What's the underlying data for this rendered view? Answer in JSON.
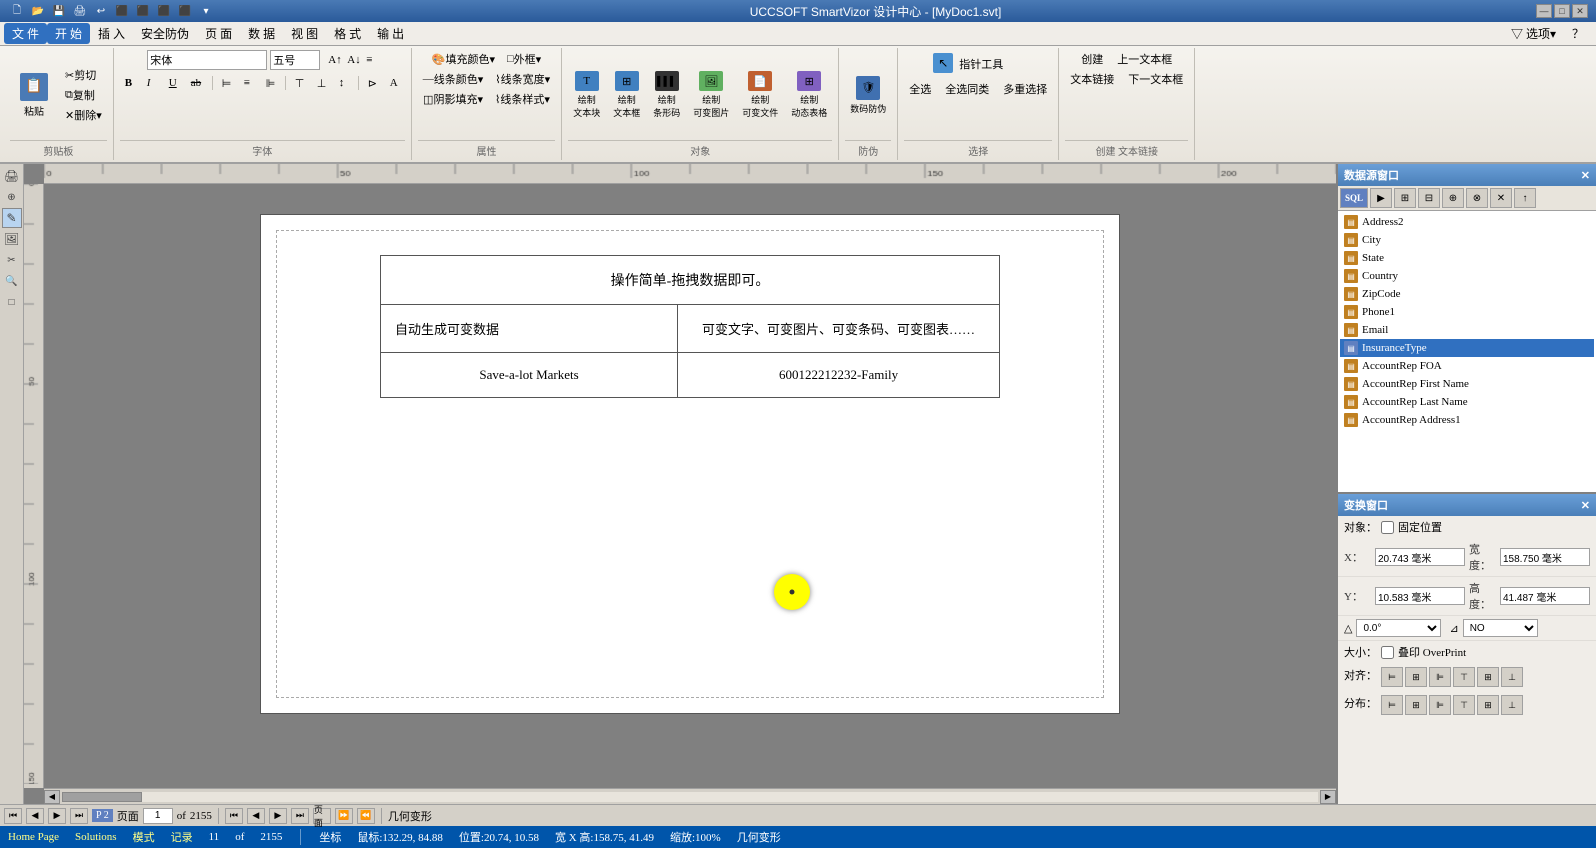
{
  "titlebar": {
    "title": "UCCSOFT SmartVizor 设计中心 - [MyDoc1.svt]",
    "min_btn": "—",
    "max_btn": "□",
    "close_btn": "✕"
  },
  "menubar": {
    "items": [
      {
        "label": "文 件",
        "active": false
      },
      {
        "label": "开 始",
        "active": true
      },
      {
        "label": "插 入",
        "active": false
      },
      {
        "label": "安全防伪",
        "active": false
      },
      {
        "label": "页 面",
        "active": false
      },
      {
        "label": "数 据",
        "active": false
      },
      {
        "label": "视 图",
        "active": false
      },
      {
        "label": "格 式",
        "active": false
      },
      {
        "label": "输 出",
        "active": false
      }
    ],
    "options_btn": "选项▾"
  },
  "ribbon": {
    "clipboard": {
      "label": "剪贴板",
      "paste_label": "粘贴",
      "cut_label": "剪切",
      "copy_label": "复制",
      "delete_label": "删除▾"
    },
    "font": {
      "label": "字体",
      "font_name": "宋体",
      "font_size": "五号",
      "bold": "B",
      "italic": "I",
      "underline": "U",
      "strikethrough": "ab",
      "align_left": "≡",
      "align_center": "≡",
      "align_right": "≡",
      "indent": "⊳"
    },
    "fill": {
      "label": "属性",
      "fill_color": "填充颜色▾",
      "stroke_color": "线条颜色▾",
      "shadow_fill": "阴影填充▾",
      "outline": "外框▾",
      "stroke_width": "线条宽度▾",
      "stroke_style": "线条样式▾"
    },
    "draw": {
      "label": "对象",
      "text_block": "绘制\n文本块",
      "text_frame": "绘制\n文本框",
      "barcode": "绘制\n条形码",
      "image": "绘制\n可变图片",
      "file": "绘制\n可变文件",
      "table": "绘制\n动态表格"
    },
    "security": {
      "label": "防伪",
      "digital_watermark": "数码防伪"
    },
    "select": {
      "label": "选择",
      "pointer": "指针工具",
      "select_all": "全选",
      "select_same": "全选同类",
      "multi_select": "多重选择"
    },
    "create_link": {
      "label": "创建 文本链接",
      "create": "创建",
      "text_link": "文本链接",
      "prev_frame": "上一文本框",
      "next_frame": "下一文本框"
    }
  },
  "canvas": {
    "page_content": {
      "header_text": "操作简单-拖拽数据即可。",
      "row1_left": "自动生成可变数据",
      "row1_right": "可变文字、可变图片、可变条码、可变图表……",
      "row2_left": "Save-a-lot Markets",
      "row2_right": "600122212232-Family"
    }
  },
  "datasource_panel": {
    "title": "数据源窗口",
    "toolbar_btns": [
      "SQL",
      "▶",
      "⊞",
      "⊟",
      "⊕",
      "⊗",
      "✕",
      "↑"
    ],
    "tree_items": [
      {
        "label": "Address2",
        "indent": 1
      },
      {
        "label": "City",
        "indent": 1,
        "selected": false
      },
      {
        "label": "State",
        "indent": 1,
        "selected": false
      },
      {
        "label": "Country",
        "indent": 1,
        "selected": false
      },
      {
        "label": "ZipCode",
        "indent": 1
      },
      {
        "label": "Phone1",
        "indent": 1
      },
      {
        "label": "Email",
        "indent": 1
      },
      {
        "label": "InsuranceType",
        "indent": 1,
        "selected": true
      },
      {
        "label": "AccountRep FOA",
        "indent": 1
      },
      {
        "label": "AccountRep First Name",
        "indent": 1
      },
      {
        "label": "AccountRep Last Name",
        "indent": 1
      },
      {
        "label": "AccountRep Address1",
        "indent": 1
      }
    ]
  },
  "transform_panel": {
    "title": "变换窗口",
    "object_label": "对象：",
    "fixed_position_label": "固定位置",
    "x_label": "X：",
    "x_value": "20.743 毫米",
    "width_label": "宽度：",
    "width_value": "158.750 毫米",
    "y_label": "Y：",
    "y_value": "10.583 毫米",
    "height_label": "高度：",
    "height_value": "41.487 毫米",
    "angle_value": "0.0°",
    "no_value": "NO",
    "size_label": "大小：",
    "overprint_label": "叠印 OverPrint",
    "align_label": "对齐：",
    "distribute_label": "分布："
  },
  "navbar": {
    "page_indicator": "P 2",
    "page_text": "页面",
    "current_page": "1",
    "of_text": "of",
    "total_pages": "2155",
    "nav_btns": [
      "⏮",
      "◀",
      "▶",
      "⏭"
    ],
    "page_btn": "页面",
    "advance_btn": "⏩",
    "mode_tabs": [
      "Home Page",
      "Solutions",
      "模式",
      "记录"
    ],
    "record_count": "11",
    "geometry_text": "几何变形"
  },
  "statusbar": {
    "text": "Home Page  Solutions  模式  记录  11  of  2155  页面  ⏮ ◀ ▶ ⏭  坐标  鼠标:132.29, 84.88  位置:20.74, 10.58  宽 X 高:158.75, 41.49  缩放:100%  几何变形"
  }
}
